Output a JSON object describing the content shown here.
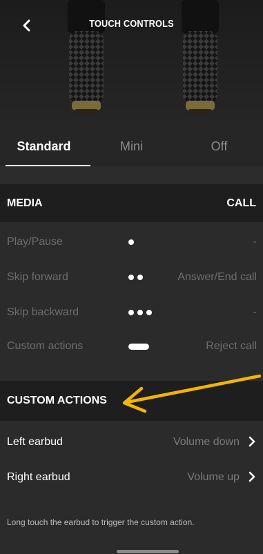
{
  "header": {
    "title": "TOUCH CONTROLS",
    "back_icon": "chevron-left-icon"
  },
  "tabs": [
    {
      "label": "Standard",
      "active": true
    },
    {
      "label": "Mini",
      "active": false
    },
    {
      "label": "Off",
      "active": false
    }
  ],
  "media_section": {
    "left_title": "MEDIA",
    "right_title": "CALL",
    "rows": [
      {
        "action": "Play/Pause",
        "gesture": "single-dot",
        "call": "-"
      },
      {
        "action": "Skip forward",
        "gesture": "double-dot",
        "call": "Answer/End call"
      },
      {
        "action": "Skip backward",
        "gesture": "triple-dot",
        "call": "-"
      },
      {
        "action": "Custom actions",
        "gesture": "long-press-pill",
        "call": "Reject call"
      }
    ]
  },
  "custom_section": {
    "title": "CUSTOM ACTIONS",
    "rows": [
      {
        "label": "Left earbud",
        "value": "Volume down"
      },
      {
        "label": "Right earbud",
        "value": "Volume up"
      }
    ],
    "note": "Long touch the earbud to trigger the custom action."
  },
  "annotation": {
    "arrow_color": "#f5b400"
  }
}
